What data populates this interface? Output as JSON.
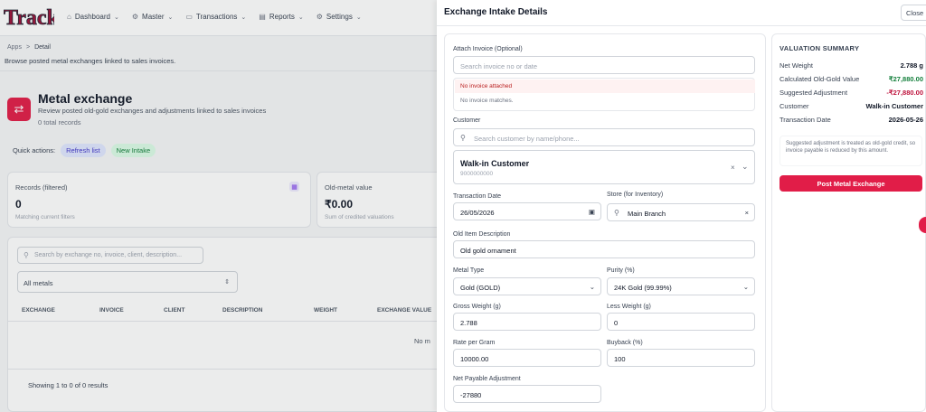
{
  "app": {
    "logo_text": "Track",
    "nav": [
      {
        "label": "Dashboard",
        "icon": "home-icon"
      },
      {
        "label": "Master",
        "icon": "gear-icon"
      },
      {
        "label": "Transactions",
        "icon": "transactions-icon"
      },
      {
        "label": "Reports",
        "icon": "document-icon"
      },
      {
        "label": "Settings",
        "icon": "gear-icon"
      }
    ]
  },
  "breadcrumb": {
    "root": "Apps",
    "sep": ">",
    "current": "Detail"
  },
  "page_subtitle": "Browse posted metal exchanges linked to sales invoices.",
  "header": {
    "title": "Metal exchange",
    "description": "Review posted old-gold exchanges and adjustments linked to sales invoices",
    "count": "0 total records"
  },
  "quick_actions": {
    "label": "Quick actions:",
    "refresh": "Refresh list",
    "new_intake": "New Intake"
  },
  "cards": {
    "records": {
      "label": "Records (filtered)",
      "value": "0",
      "sub": "Matching current filters"
    },
    "old_metal": {
      "label": "Old-metal value",
      "value": "₹0.00",
      "sub": "Sum of credited valuations"
    }
  },
  "table": {
    "search_placeholder": "Search by exchange no, invoice, client, description...",
    "filter_value": "All metals",
    "columns": [
      "EXCHANGE",
      "INVOICE",
      "CLIENT",
      "DESCRIPTION",
      "WEIGHT",
      "EXCHANGE VALUE"
    ],
    "empty": "No m",
    "footer": "Showing 1 to 0 of 0 results"
  },
  "drawer": {
    "title": "Exchange Intake Details",
    "close": "Close",
    "attach_label": "Attach Invoice (Optional)",
    "attach_placeholder": "Search invoice no or date",
    "alert": "No invoice attached",
    "alert_sub": "No invoice matches.",
    "customer_label": "Customer",
    "customer_search_placeholder": "Search customer by name/phone...",
    "customer_name": "Walk-in Customer",
    "customer_phone": "9000000000",
    "txn_date_label": "Transaction Date",
    "txn_date_value": "26/05/2026",
    "store_label": "Store (for Inventory)",
    "store_value": "Main Branch",
    "old_item_label": "Old Item Description",
    "old_item_value": "Old gold ornament",
    "metal_type_label": "Metal Type",
    "metal_type_value": "Gold (GOLD)",
    "purity_label": "Purity (%)",
    "purity_value": "24K Gold (99.99%)",
    "gross_label": "Gross Weight (g)",
    "gross_value": "2.788",
    "less_label": "Less Weight (g)",
    "less_value": "0",
    "rate_label": "Rate per Gram",
    "rate_value": "10000.00",
    "buyback_label": "Buyback (%)",
    "buyback_value": "100",
    "net_label": "Net Payable Adjustment",
    "net_value": "-27880"
  },
  "summary": {
    "title": "VALUATION SUMMARY",
    "rows": [
      {
        "label": "Net Weight",
        "value": "2.788 g"
      },
      {
        "label": "Calculated Old-Gold Value",
        "value": "₹27,880.00"
      },
      {
        "label": "Suggested Adjustment",
        "value": "-₹27,880.00"
      },
      {
        "label": "Customer",
        "value": "Walk-in Customer"
      },
      {
        "label": "Transaction Date",
        "value": "2026-05-26"
      }
    ],
    "note": "Suggested adjustment is treated as old-gold credit, so invoice payable is reduced by this amount.",
    "button": "Post Metal Exchange"
  },
  "colors": {
    "accent": "#e11d48",
    "positive": "#15803d",
    "negative": "#be123c"
  }
}
